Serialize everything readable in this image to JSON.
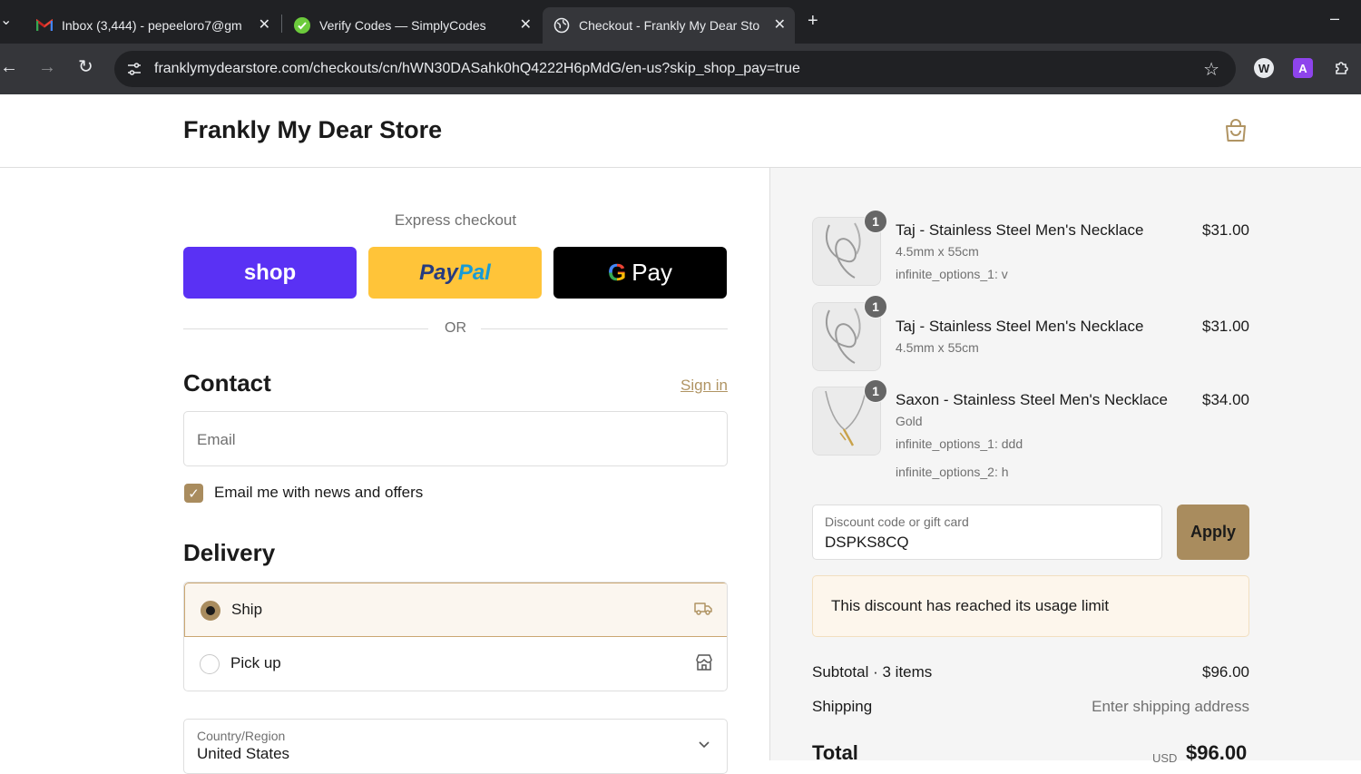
{
  "browser": {
    "tabs": [
      {
        "title": "Inbox (3,444) - pepeeloro7@gm",
        "icon": "gmail-icon",
        "active": false
      },
      {
        "title": "Verify Codes — SimplyCodes",
        "icon": "simplycodes-icon",
        "active": false
      },
      {
        "title": "Checkout - Frankly My Dear Sto",
        "icon": "globe-icon",
        "active": true
      }
    ],
    "new_tab": "+",
    "minimize": "–",
    "url": "franklymydearstore.com/checkouts/cn/hWN30DASahk0hQ4222H6pMdG/en-us?skip_shop_pay=true",
    "extensions": [
      {
        "icon": "w-extension-icon",
        "label": "W"
      },
      {
        "icon": "a-extension-icon",
        "label": "A"
      }
    ]
  },
  "store": {
    "name": "Frankly My Dear Store"
  },
  "express": {
    "label": "Express checkout",
    "shop": "shop",
    "paypal_a": "Pay",
    "paypal_b": "Pal",
    "gpay_g": "G",
    "gpay_text": "Pay",
    "or": "OR"
  },
  "contact": {
    "title": "Contact",
    "sign_in": "Sign in",
    "email_placeholder": "Email",
    "newsletter_label": "Email me with news and offers",
    "newsletter_checked": true
  },
  "delivery": {
    "title": "Delivery",
    "options": [
      {
        "label": "Ship",
        "selected": true,
        "icon": "truck-icon"
      },
      {
        "label": "Pick up",
        "selected": false,
        "icon": "store-icon"
      }
    ],
    "country_label": "Country/Region",
    "country_value": "United States"
  },
  "cart": {
    "items": [
      {
        "name": "Taj - Stainless Steel Men's Necklace",
        "price": "$31.00",
        "qty": "1",
        "variant": "4.5mm x 55cm",
        "options": [
          "infinite_options_1: v"
        ]
      },
      {
        "name": "Taj - Stainless Steel Men's Necklace",
        "price": "$31.00",
        "qty": "1",
        "variant": "4.5mm x 55cm",
        "options": []
      },
      {
        "name": "Saxon - Stainless Steel Men's Necklace",
        "price": "$34.00",
        "qty": "1",
        "variant": "Gold",
        "options": [
          "infinite_options_1: ddd",
          "infinite_options_2: h"
        ]
      }
    ],
    "discount_label": "Discount code or gift card",
    "discount_value": "DSPKS8CQ",
    "apply": "Apply",
    "discount_error": "This discount has reached its usage limit",
    "subtotal_label": "Subtotal · 3 items",
    "subtotal_value": "$96.00",
    "shipping_label": "Shipping",
    "shipping_value": "Enter shipping address",
    "total_label": "Total",
    "total_currency": "USD",
    "total_value": "$96.00"
  },
  "colors": {
    "accent": "#a98c5e",
    "shop": "#5a31f4",
    "paypal": "#ffc439"
  }
}
